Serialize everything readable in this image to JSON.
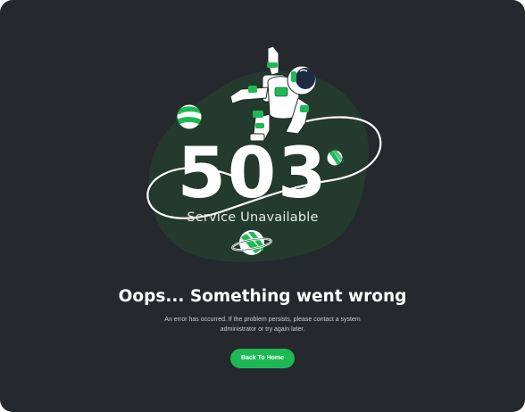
{
  "error": {
    "code": "503",
    "status": "Service Unavailable"
  },
  "content": {
    "headline": "Oops... Something went wrong",
    "message": "An error has occurred. If the problem persists, please contact a system administrator or try again later."
  },
  "actions": {
    "home_label": "Back To Home"
  },
  "illustration": {
    "icons": [
      "astronaut-illustration",
      "planet-icon",
      "planet-icon",
      "ringed-planet-icon",
      "tether-rope"
    ]
  },
  "colors": {
    "background": "#25282d",
    "blob": "#243a2e",
    "accent": "#1db954",
    "text_primary": "#ffffff",
    "text_secondary": "#c9ccd0"
  }
}
